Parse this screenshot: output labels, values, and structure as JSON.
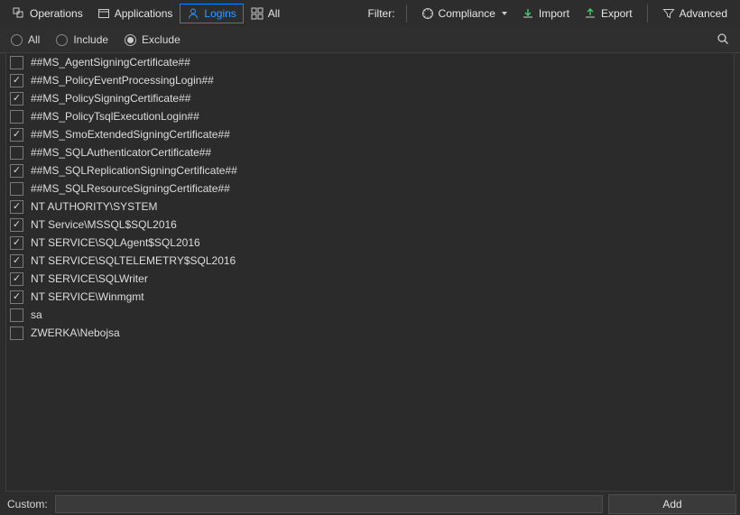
{
  "toolbar": {
    "operations": "Operations",
    "applications": "Applications",
    "logins": "Logins",
    "all": "All",
    "filter_label": "Filter:",
    "compliance": "Compliance",
    "import": "Import",
    "export": "Export",
    "advanced": "Advanced"
  },
  "filter_row": {
    "options": [
      "All",
      "Include",
      "Exclude"
    ],
    "selected": "Exclude"
  },
  "logins": [
    {
      "label": "##MS_AgentSigningCertificate##",
      "checked": false
    },
    {
      "label": "##MS_PolicyEventProcessingLogin##",
      "checked": true
    },
    {
      "label": "##MS_PolicySigningCertificate##",
      "checked": true
    },
    {
      "label": "##MS_PolicyTsqlExecutionLogin##",
      "checked": false
    },
    {
      "label": "##MS_SmoExtendedSigningCertificate##",
      "checked": true
    },
    {
      "label": "##MS_SQLAuthenticatorCertificate##",
      "checked": false
    },
    {
      "label": "##MS_SQLReplicationSigningCertificate##",
      "checked": true
    },
    {
      "label": "##MS_SQLResourceSigningCertificate##",
      "checked": false
    },
    {
      "label": "NT AUTHORITY\\SYSTEM",
      "checked": true
    },
    {
      "label": "NT Service\\MSSQL$SQL2016",
      "checked": true
    },
    {
      "label": "NT SERVICE\\SQLAgent$SQL2016",
      "checked": true
    },
    {
      "label": "NT SERVICE\\SQLTELEMETRY$SQL2016",
      "checked": true
    },
    {
      "label": "NT SERVICE\\SQLWriter",
      "checked": true
    },
    {
      "label": "NT SERVICE\\Winmgmt",
      "checked": true
    },
    {
      "label": "sa",
      "checked": false
    },
    {
      "label": "ZWERKA\\Nebojsa",
      "checked": false
    }
  ],
  "bottom": {
    "custom_label": "Custom:",
    "custom_value": "",
    "add_label": "Add"
  }
}
